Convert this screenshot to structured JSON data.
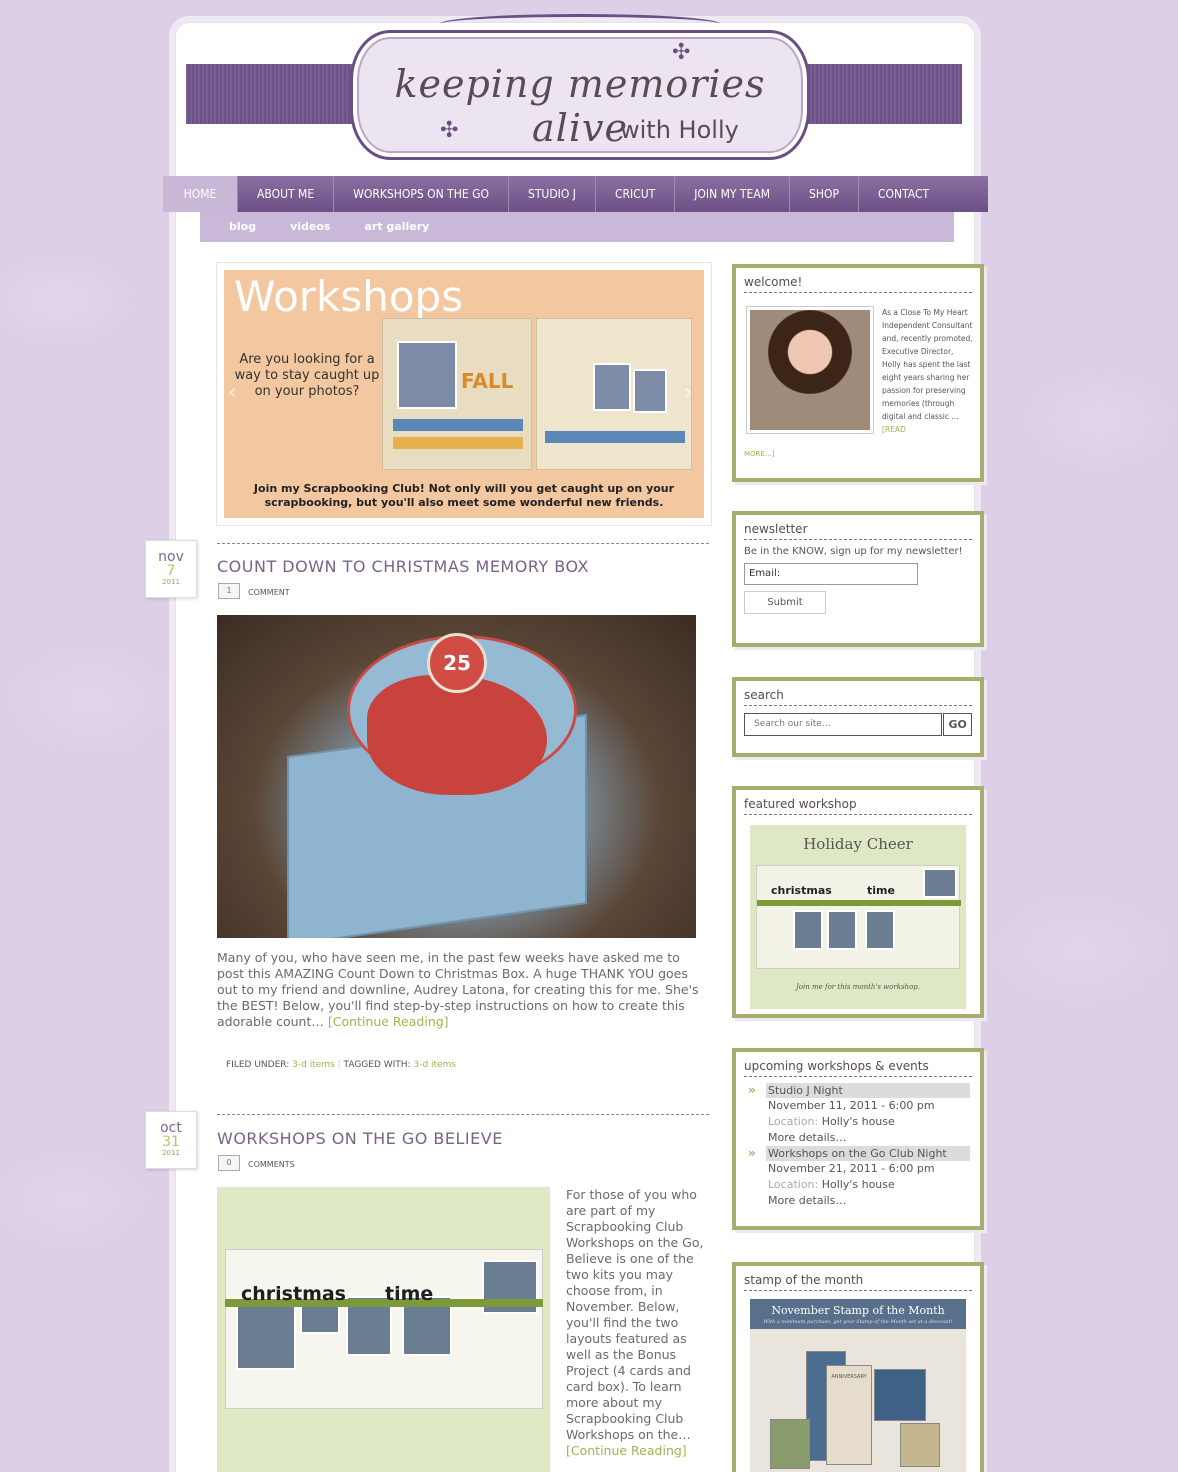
{
  "site": {
    "logo_title": "keeping memories alive",
    "logo_sub": "with Holly"
  },
  "nav": {
    "items": [
      "HOME",
      "ABOUT ME",
      "WORKSHOPS ON THE GO",
      "STUDIO J",
      "CRICUT",
      "JOIN MY TEAM",
      "SHOP",
      "CONTACT"
    ],
    "active": "HOME"
  },
  "subnav": {
    "items": [
      "blog",
      "videos",
      "art gallery"
    ]
  },
  "slider": {
    "title": "Workshops",
    "question": "Are you looking for a way to stay caught up on your photos?",
    "photo_word": "FALL",
    "caption": "Join my Scrapbooking Club!  Not only will you get caught up on your scrapbooking, but you'll also meet some wonderful new friends."
  },
  "posts": [
    {
      "month": "nov",
      "day": "7",
      "year": "2011",
      "title": "COUNT DOWN TO CHRISTMAS MEMORY BOX",
      "comment_count": "1",
      "comment_label": "COMMENT",
      "image_badge": "25",
      "excerpt": "Many of you, who have seen me, in the past few weeks have asked me to post this AMAZING Count Down to Christmas Box.  A huge THANK YOU goes out to my friend and downline, Audrey Latona, for creating this for me. She's the BEST! Below, you'll find step-by-step instructions on how to create this adorable count…",
      "more": "[Continue Reading]",
      "filed_label": "FILED UNDER:",
      "filed_value": "3-d items",
      "tagged_label": "TAGGED WITH:",
      "tagged_value": "3-d items"
    },
    {
      "month": "oct",
      "day": "31",
      "year": "2011",
      "title": "WORKSHOPS ON THE GO BELIEVE",
      "comment_count": "0",
      "comment_label": "COMMENTS",
      "image_word1": "christmas",
      "image_word2": "time",
      "excerpt": "For those of you who are part of my Scrapbooking Club Workshops on the Go, Believe is one of the two kits you may choose from, in November.  Below, you'll find the two layouts featured as well as the Bonus Project (4 cards and card box).  To learn more about my Scrapbooking Club Workshops on the…",
      "more": "[Continue Reading]"
    }
  ],
  "sidebar": {
    "welcome": {
      "title": "welcome!",
      "text": "As a Close To My Heart Independent Consultant and, recently promoted, Executive Director, Holly has spent the last eight years sharing her passion for preserving memories (through digital and classic …",
      "more_a": "[READ",
      "more_b": "MORE…]"
    },
    "newsletter": {
      "title": "newsletter",
      "text": "Be in the KNOW, sign up for my newsletter!",
      "email_value": "Email:",
      "submit": "Submit"
    },
    "search": {
      "title": "search",
      "placeholder": "Search our site…",
      "button": "GO"
    },
    "featured": {
      "title": "featured workshop",
      "image_title": "Holiday Cheer",
      "image_word1": "christmas",
      "image_word2": "time",
      "image_caption": "Join me for this month's workshop."
    },
    "events": {
      "title": "upcoming workshops & events",
      "location_label": "Location:",
      "items": [
        {
          "name": "Studio J Night",
          "date": "November 11, 2011 - 6:00 pm",
          "location": "Holly's house",
          "details": "More details…"
        },
        {
          "name": "Workshops on the Go Club Night",
          "date": "November 21, 2011 - 6:00 pm",
          "location": "Holly's house",
          "details": "More details…"
        }
      ]
    },
    "stamp": {
      "title": "stamp of the month",
      "image_title": "November Stamp of the Month",
      "image_sub": "With a minimum purchase, get your Stamp of the Month set at a discount!",
      "card_word": "ANNIVERSARY"
    }
  },
  "colors": {
    "background": "#dccfe6",
    "nav": "#6c5086",
    "accent_green": "#a4b24e",
    "widget_border": "#a7ad6c",
    "title_purple": "#7a6188"
  }
}
